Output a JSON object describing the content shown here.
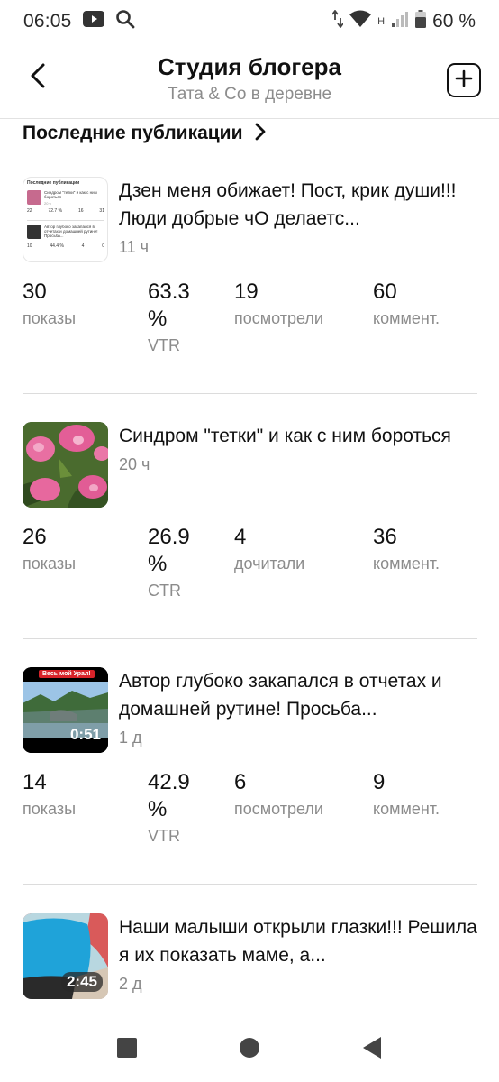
{
  "status_bar": {
    "time": "06:05",
    "network": "H",
    "battery": "60 %"
  },
  "header": {
    "title": "Студия блогера",
    "subtitle": "Тата & Co в деревне"
  },
  "section": {
    "title": "Последние публикации"
  },
  "posts": [
    {
      "title": "Дзен меня обижает! Пост, крик души!!! Люди добрые чО делаетс...",
      "time": "11 ч",
      "stats": [
        {
          "value": "30",
          "label": "показы"
        },
        {
          "value": "63.3",
          "unit": "%",
          "label": "VTR"
        },
        {
          "value": "19",
          "label": "посмотрели"
        },
        {
          "value": "60",
          "label": "коммент."
        }
      ]
    },
    {
      "title": "Синдром \"тетки\" и как с ним бороться",
      "time": "20 ч",
      "stats": [
        {
          "value": "26",
          "label": "показы"
        },
        {
          "value": "26.9",
          "unit": "%",
          "label": "CTR"
        },
        {
          "value": "4",
          "label": "дочитали"
        },
        {
          "value": "36",
          "label": "коммент."
        }
      ]
    },
    {
      "title": "Автор глубоко закапался в отчетах и домашней рутине! Просьба...",
      "time": "1 д",
      "duration": "0:51",
      "banner": "Весь мой Урал!",
      "stats": [
        {
          "value": "14",
          "label": "показы"
        },
        {
          "value": "42.9",
          "unit": "%",
          "label": "VTR"
        },
        {
          "value": "6",
          "label": "посмотрели"
        },
        {
          "value": "9",
          "label": "коммент."
        }
      ]
    },
    {
      "title": "Наши малыши открыли глазки!!! Решила я их показать маме, а...",
      "time": "2 д",
      "duration": "2:45"
    }
  ],
  "thumb1_text": {
    "header": "Последние публикации",
    "row1_title": "Синдром \"тетки\" и как с ним бороться",
    "row1_time": "20 ч",
    "row1_stats": [
      "22",
      "72.7 %",
      "16",
      "31"
    ],
    "row2_title": "Автор глубоко закапался в отчетах и домашней рутине! Просьба...",
    "row2_stats": [
      "10",
      "44.4 %",
      "4",
      "0"
    ]
  },
  "icons": {
    "back": "chevron-left-icon",
    "add": "plus-square-icon",
    "section_arrow": "chevron-right-icon"
  },
  "colors": {
    "text": "#111111",
    "muted": "#8c8c8c",
    "divider": "#dcdcdc"
  }
}
